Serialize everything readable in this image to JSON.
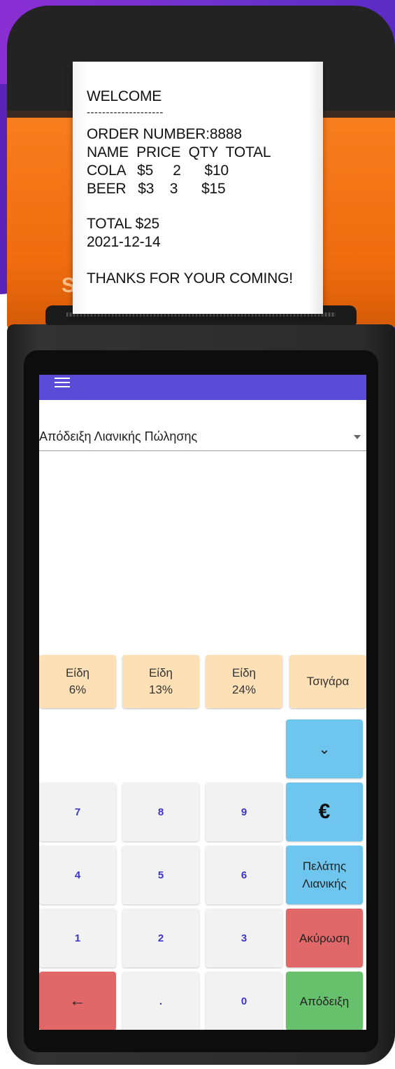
{
  "receipt": {
    "title": "WELCOME",
    "divider": "--------------------",
    "order_number": "ORDER NUMBER:8888",
    "header": "NAME  PRICE  QTY  TOTAL",
    "rows": [
      "COLA   $5     2      $10",
      "BEER   $3    3      $15"
    ],
    "total": "TOTAL $25",
    "date": "2021-12-14",
    "thanks": "THANKS FOR YOUR COMING!"
  },
  "device": {
    "logo_text": "S"
  },
  "app": {
    "appbar_color": "#5a4cd6",
    "menu_icon": "menu-icon",
    "document_type": {
      "selected": "Απόδειξη Λιανικής Πώλησης"
    },
    "categories": [
      {
        "line1": "Είδη",
        "line2": "6%"
      },
      {
        "line1": "Είδη",
        "line2": "13%"
      },
      {
        "line1": "Είδη",
        "line2": "24%"
      },
      {
        "line1": "Τσιγάρα",
        "line2": ""
      }
    ],
    "keypad": {
      "rows": [
        [
          "7",
          "8",
          "9"
        ],
        [
          "4",
          "5",
          "6"
        ],
        [
          "1",
          "2",
          "3"
        ],
        [
          "",
          ".",
          "0"
        ]
      ],
      "backspace_icon": "←"
    },
    "actions": {
      "collapse_icon": "⌄",
      "currency": "€",
      "customer_line1": "Πελάτης",
      "customer_line2": "Λιανικής",
      "cancel": "Ακύρωση",
      "receipt": "Απόδειξη"
    },
    "colors": {
      "category": "#fde0b6",
      "blue": "#6ec6ee",
      "red": "#e06868",
      "green": "#67c06b",
      "digit": "#3d35c8"
    }
  }
}
